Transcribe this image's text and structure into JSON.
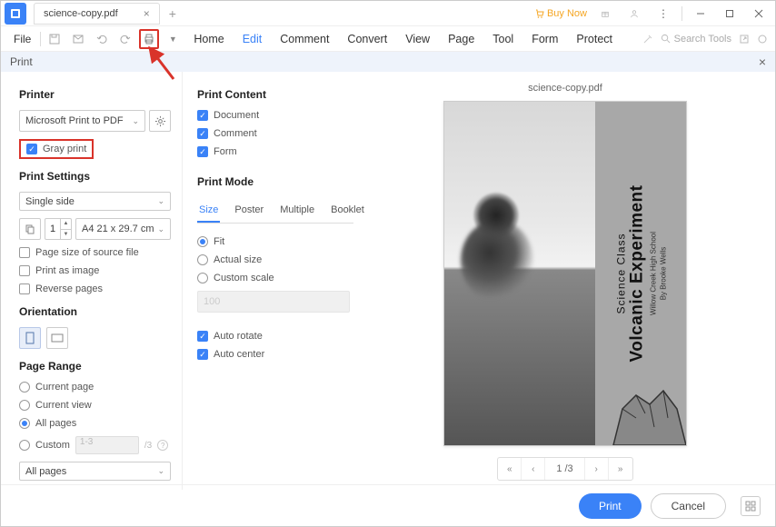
{
  "titlebar": {
    "tab_title": "science-copy.pdf",
    "buy_now": "Buy Now"
  },
  "menubar": {
    "file": "File",
    "items": [
      "Home",
      "Edit",
      "Comment",
      "Convert",
      "View",
      "Page",
      "Tool",
      "Form",
      "Protect"
    ],
    "search_placeholder": "Search Tools"
  },
  "print_header": "Print",
  "left": {
    "printer_title": "Printer",
    "printer_select": "Microsoft Print to PDF",
    "gray_print": "Gray print",
    "settings_title": "Print Settings",
    "sides": "Single side",
    "copies": "1",
    "paper": "A4 21 x 29.7 cm",
    "page_size_source": "Page size of source file",
    "print_as_image": "Print as image",
    "reverse_pages": "Reverse pages",
    "orientation_title": "Orientation",
    "page_range_title": "Page Range",
    "current_page": "Current page",
    "current_view": "Current view",
    "all_pages": "All pages",
    "custom": "Custom",
    "custom_placeholder": "1-3",
    "custom_total": "/3",
    "range_select": "All pages"
  },
  "mid": {
    "content_title": "Print Content",
    "document": "Document",
    "comment": "Comment",
    "form": "Form",
    "mode_title": "Print Mode",
    "tabs": [
      "Size",
      "Poster",
      "Multiple",
      "Booklet"
    ],
    "fit": "Fit",
    "actual": "Actual size",
    "custom_scale": "Custom scale",
    "scale_value": "100",
    "auto_rotate": "Auto rotate",
    "auto_center": "Auto center"
  },
  "preview": {
    "filename": "science-copy.pdf",
    "doc_line1": "Science Class",
    "doc_line2": "Volcanic Experiment",
    "doc_line3": "Willow Creek High School",
    "doc_line4": "By Brooke Wells",
    "page_indicator": "1 /3"
  },
  "footer": {
    "print": "Print",
    "cancel": "Cancel"
  }
}
